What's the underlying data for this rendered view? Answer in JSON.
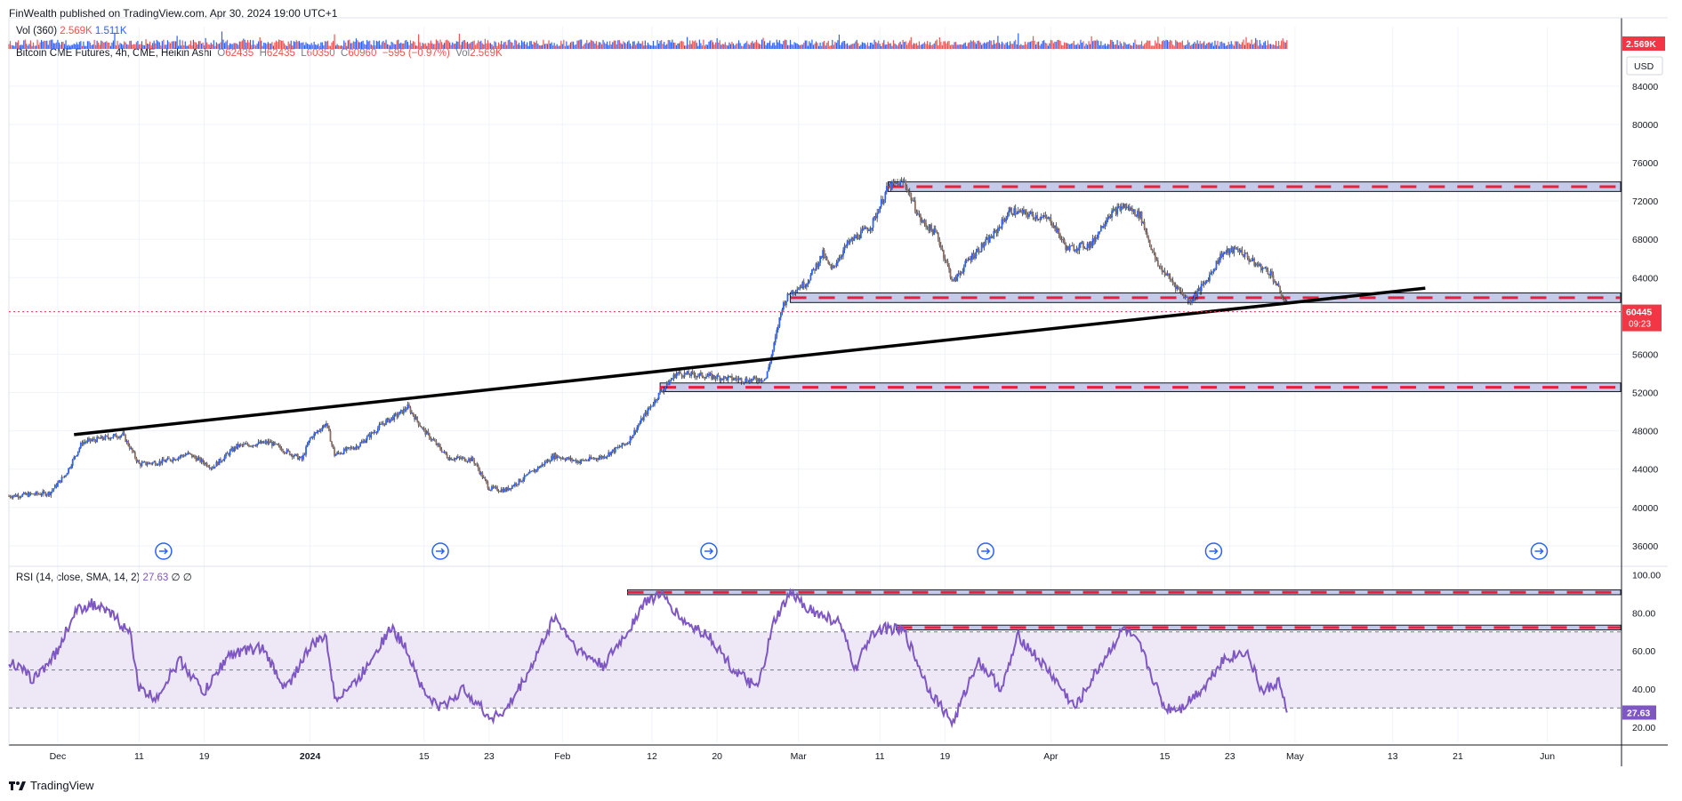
{
  "header": {
    "published": "FinWealth published on TradingView.com, Apr 30, 2024 19:00 UTC+1",
    "vol_label": "Vol (360)",
    "vol_val1": "2.569K",
    "vol_val2": "1.511K",
    "main_legend": "Bitcoin CME Futures, 4h, CME, Heikin Ashi",
    "ohlc": {
      "O": "62435",
      "H": "62435",
      "L": "60350",
      "C": "60960",
      "chg": "−595 (−0.97%)",
      "vol": "2.569K"
    },
    "rsi_label": "RSI (14, close, SMA, 14, 2)",
    "rsi_val": "27.63",
    "rsi_extra": "∅ ∅"
  },
  "footer": {
    "brand": "TradingView",
    "logo": "tradingview-logo-icon"
  },
  "price_scale": {
    "currency": "USD",
    "vol_badge": "2.569K",
    "current_price": "60445",
    "countdown": "09:23",
    "ticks": [
      "84000",
      "80000",
      "76000",
      "72000",
      "68000",
      "64000",
      "60000",
      "56000",
      "52000",
      "48000",
      "44000",
      "40000",
      "36000"
    ]
  },
  "rsi_scale": {
    "ticks": [
      "100.00",
      "80.00",
      "60.00",
      "40.00",
      "20.00"
    ],
    "badge": "27.63"
  },
  "time_axis": {
    "labels": [
      "Dec",
      "11",
      "19",
      "2024",
      "15",
      "23",
      "Feb",
      "12",
      "20",
      "Mar",
      "11",
      "19",
      "Apr",
      "15",
      "23",
      "May",
      "13",
      "21",
      "Jun"
    ],
    "bold": [
      "2024"
    ]
  },
  "colors": {
    "up": "#2962ff",
    "down": "#8d6e63",
    "rsi_line": "#7e57c2",
    "rsi_band": "#ede7f6",
    "zone_fill": "#c5cae9",
    "zone_dash": "#e91e3c",
    "trendline": "#000000",
    "vol_up": "#2962ff",
    "vol_down": "#ef5350",
    "price_badge": "#f23645"
  },
  "chart_data": [
    {
      "type": "candlestick",
      "title": "Bitcoin CME Futures, 4h, CME, Heikin Ashi",
      "ylim": [
        34500,
        86500
      ],
      "x_range": [
        "2023-11-25",
        "2024-06-10"
      ],
      "price_path": [
        [
          "2023-11-25",
          41200
        ],
        [
          "2023-11-30",
          41500
        ],
        [
          "2023-12-02",
          43500
        ],
        [
          "2023-12-04",
          46800
        ],
        [
          "2023-12-07",
          47300
        ],
        [
          "2023-12-09",
          47600
        ],
        [
          "2023-12-11",
          44500
        ],
        [
          "2023-12-14",
          44800
        ],
        [
          "2023-12-17",
          45600
        ],
        [
          "2023-12-20",
          44200
        ],
        [
          "2023-12-23",
          46400
        ],
        [
          "2023-12-27",
          46800
        ],
        [
          "2023-12-31",
          45000
        ],
        [
          "2024-01-01",
          47200
        ],
        [
          "2024-01-03",
          48800
        ],
        [
          "2024-01-04",
          45500
        ],
        [
          "2024-01-07",
          46500
        ],
        [
          "2024-01-10",
          48800
        ],
        [
          "2024-01-12",
          49800
        ],
        [
          "2024-01-13",
          50500
        ],
        [
          "2024-01-15",
          48000
        ],
        [
          "2024-01-18",
          45200
        ],
        [
          "2024-01-21",
          45000
        ],
        [
          "2024-01-23",
          42000
        ],
        [
          "2024-01-25",
          41800
        ],
        [
          "2024-01-28",
          43500
        ],
        [
          "2024-01-31",
          45400
        ],
        [
          "2024-02-03",
          44800
        ],
        [
          "2024-02-06",
          45300
        ],
        [
          "2024-02-09",
          46800
        ],
        [
          "2024-02-11",
          49500
        ],
        [
          "2024-02-13",
          52000
        ],
        [
          "2024-02-15",
          54000
        ],
        [
          "2024-02-18",
          53800
        ],
        [
          "2024-02-21",
          53500
        ],
        [
          "2024-02-24",
          53300
        ],
        [
          "2024-02-26",
          53500
        ],
        [
          "2024-02-27",
          57000
        ],
        [
          "2024-02-28",
          61000
        ],
        [
          "2024-02-29",
          62500
        ],
        [
          "2024-03-02",
          63500
        ],
        [
          "2024-03-04",
          66500
        ],
        [
          "2024-03-05",
          64800
        ],
        [
          "2024-03-07",
          67500
        ],
        [
          "2024-03-10",
          69500
        ],
        [
          "2024-03-12",
          73500
        ],
        [
          "2024-03-14",
          74000
        ],
        [
          "2024-03-16",
          70000
        ],
        [
          "2024-03-18",
          68500
        ],
        [
          "2024-03-20",
          63500
        ],
        [
          "2024-03-22",
          66000
        ],
        [
          "2024-03-25",
          68500
        ],
        [
          "2024-03-27",
          71000
        ],
        [
          "2024-03-30",
          70500
        ],
        [
          "2024-04-01",
          70000
        ],
        [
          "2024-04-03",
          67000
        ],
        [
          "2024-04-06",
          67500
        ],
        [
          "2024-04-08",
          70500
        ],
        [
          "2024-04-10",
          71500
        ],
        [
          "2024-04-12",
          70500
        ],
        [
          "2024-04-14",
          65500
        ],
        [
          "2024-04-16",
          63500
        ],
        [
          "2024-04-18",
          61500
        ],
        [
          "2024-04-20",
          63500
        ],
        [
          "2024-04-22",
          66500
        ],
        [
          "2024-04-24",
          67000
        ],
        [
          "2024-04-26",
          65500
        ],
        [
          "2024-04-28",
          64500
        ],
        [
          "2024-04-30",
          61000
        ]
      ],
      "current_price": 60445,
      "trendline": [
        [
          "2023-12-03",
          47600
        ],
        [
          "2024-05-17",
          62900
        ]
      ],
      "zones": [
        {
          "from": "2024-03-12",
          "low": 73000,
          "high": 74000
        },
        {
          "from": "2024-02-29",
          "low": 61400,
          "high": 62400
        },
        {
          "from": "2024-02-13",
          "low": 52100,
          "high": 53000
        }
      ]
    },
    {
      "type": "line",
      "title": "RSI (14, close, SMA, 14, 2)",
      "ylim": [
        12,
        103
      ],
      "band": [
        30,
        70
      ],
      "midline": 50,
      "path": [
        [
          "2023-11-25",
          55
        ],
        [
          "2023-11-28",
          45
        ],
        [
          "2023-12-01",
          60
        ],
        [
          "2023-12-03",
          80
        ],
        [
          "2023-12-05",
          85
        ],
        [
          "2023-12-08",
          78
        ],
        [
          "2023-12-10",
          68
        ],
        [
          "2023-12-11",
          40
        ],
        [
          "2023-12-13",
          35
        ],
        [
          "2023-12-16",
          55
        ],
        [
          "2023-12-19",
          38
        ],
        [
          "2023-12-22",
          58
        ],
        [
          "2023-12-26",
          62
        ],
        [
          "2023-12-29",
          40
        ],
        [
          "2024-01-01",
          62
        ],
        [
          "2024-01-03",
          68
        ],
        [
          "2024-01-04",
          35
        ],
        [
          "2024-01-07",
          45
        ],
        [
          "2024-01-09",
          60
        ],
        [
          "2024-01-11",
          72
        ],
        [
          "2024-01-13",
          60
        ],
        [
          "2024-01-15",
          38
        ],
        [
          "2024-01-17",
          30
        ],
        [
          "2024-01-20",
          40
        ],
        [
          "2024-01-23",
          25
        ],
        [
          "2024-01-25",
          28
        ],
        [
          "2024-01-28",
          50
        ],
        [
          "2024-01-31",
          78
        ],
        [
          "2024-02-03",
          60
        ],
        [
          "2024-02-06",
          52
        ],
        [
          "2024-02-09",
          70
        ],
        [
          "2024-02-11",
          85
        ],
        [
          "2024-02-13",
          90
        ],
        [
          "2024-02-16",
          75
        ],
        [
          "2024-02-19",
          68
        ],
        [
          "2024-02-22",
          50
        ],
        [
          "2024-02-25",
          40
        ],
        [
          "2024-02-27",
          75
        ],
        [
          "2024-02-29",
          90
        ],
        [
          "2024-03-03",
          80
        ],
        [
          "2024-03-06",
          75
        ],
        [
          "2024-03-08",
          50
        ],
        [
          "2024-03-10",
          70
        ],
        [
          "2024-03-12",
          72
        ],
        [
          "2024-03-14",
          70
        ],
        [
          "2024-03-17",
          40
        ],
        [
          "2024-03-20",
          22
        ],
        [
          "2024-03-23",
          55
        ],
        [
          "2024-03-26",
          40
        ],
        [
          "2024-03-28",
          68
        ],
        [
          "2024-04-01",
          48
        ],
        [
          "2024-04-04",
          30
        ],
        [
          "2024-04-07",
          52
        ],
        [
          "2024-04-10",
          72
        ],
        [
          "2024-04-12",
          62
        ],
        [
          "2024-04-15",
          30
        ],
        [
          "2024-04-17",
          30
        ],
        [
          "2024-04-20",
          42
        ],
        [
          "2024-04-22",
          55
        ],
        [
          "2024-04-25",
          60
        ],
        [
          "2024-04-27",
          38
        ],
        [
          "2024-04-29",
          44
        ],
        [
          "2024-04-30",
          27.63
        ]
      ],
      "zones": [
        {
          "from": "2024-02-09",
          "low": 89.5,
          "high": 92
        },
        {
          "from": "2024-03-13",
          "low": 71,
          "high": 73.5
        }
      ]
    }
  ]
}
